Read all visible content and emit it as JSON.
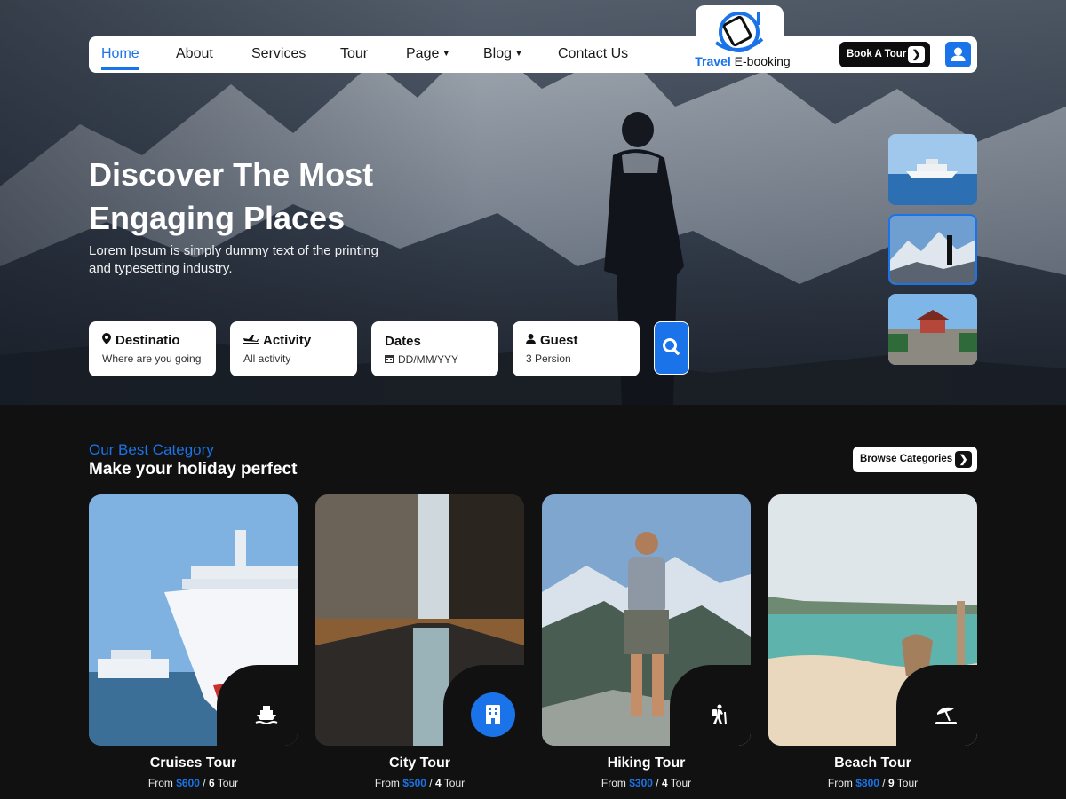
{
  "nav": {
    "items": [
      {
        "label": "Home",
        "active": true,
        "dropdown": false
      },
      {
        "label": "About",
        "active": false,
        "dropdown": false
      },
      {
        "label": "Services",
        "active": false,
        "dropdown": false
      },
      {
        "label": "Tour",
        "active": false,
        "dropdown": false
      },
      {
        "label": "Page",
        "active": false,
        "dropdown": true
      },
      {
        "label": "Blog",
        "active": false,
        "dropdown": true
      },
      {
        "label": "Contact Us",
        "active": false,
        "dropdown": false
      }
    ],
    "logo": {
      "part1": "Travel",
      "part2": "E-booking"
    },
    "book_label": "Book A Tour",
    "user_icon": "user-icon"
  },
  "hero": {
    "title": "Discover The Most Engaging Places",
    "subtitle": "Lorem Ipsum is simply dummy text of the printing and typesetting industry."
  },
  "search": {
    "fields": [
      {
        "label": "Destinatio",
        "value": "Where are you going",
        "icon": "map-pin-icon"
      },
      {
        "label": "Activity",
        "value": "All activity",
        "icon": "plane-icon"
      },
      {
        "label": "Dates",
        "value": "DD/MM/YYY",
        "icon": "calendar-icon"
      },
      {
        "label": "Guest",
        "value": "3 Persion",
        "icon": "person-icon"
      }
    ],
    "button_icon": "search-icon"
  },
  "thumbnails": [
    {
      "name": "cruise",
      "selected": false
    },
    {
      "name": "mountain",
      "selected": true
    },
    {
      "name": "temple",
      "selected": false
    }
  ],
  "category": {
    "kicker": "Our Best Category",
    "title": "Make your holiday perfect",
    "browse_label": "Browse Categories",
    "cards": [
      {
        "name": "Cruises Tour",
        "from": "From",
        "price": "$600",
        "sep": "/",
        "count": "6",
        "unit": "Tour",
        "icon": "ship-icon",
        "highlight": false
      },
      {
        "name": "City Tour",
        "from": "From",
        "price": "$500",
        "sep": "/",
        "count": "4",
        "unit": "Tour",
        "icon": "building-icon",
        "highlight": true
      },
      {
        "name": "Hiking Tour",
        "from": "From",
        "price": "$300",
        "sep": "/",
        "count": "4",
        "unit": "Tour",
        "icon": "hiker-icon",
        "highlight": false
      },
      {
        "name": "Beach Tour",
        "from": "From",
        "price": "$800",
        "sep": "/",
        "count": "9",
        "unit": "Tour",
        "icon": "umbrella-beach-icon",
        "highlight": false
      }
    ]
  },
  "colors": {
    "accent": "#1a73e8",
    "dark_bg": "#111111"
  }
}
